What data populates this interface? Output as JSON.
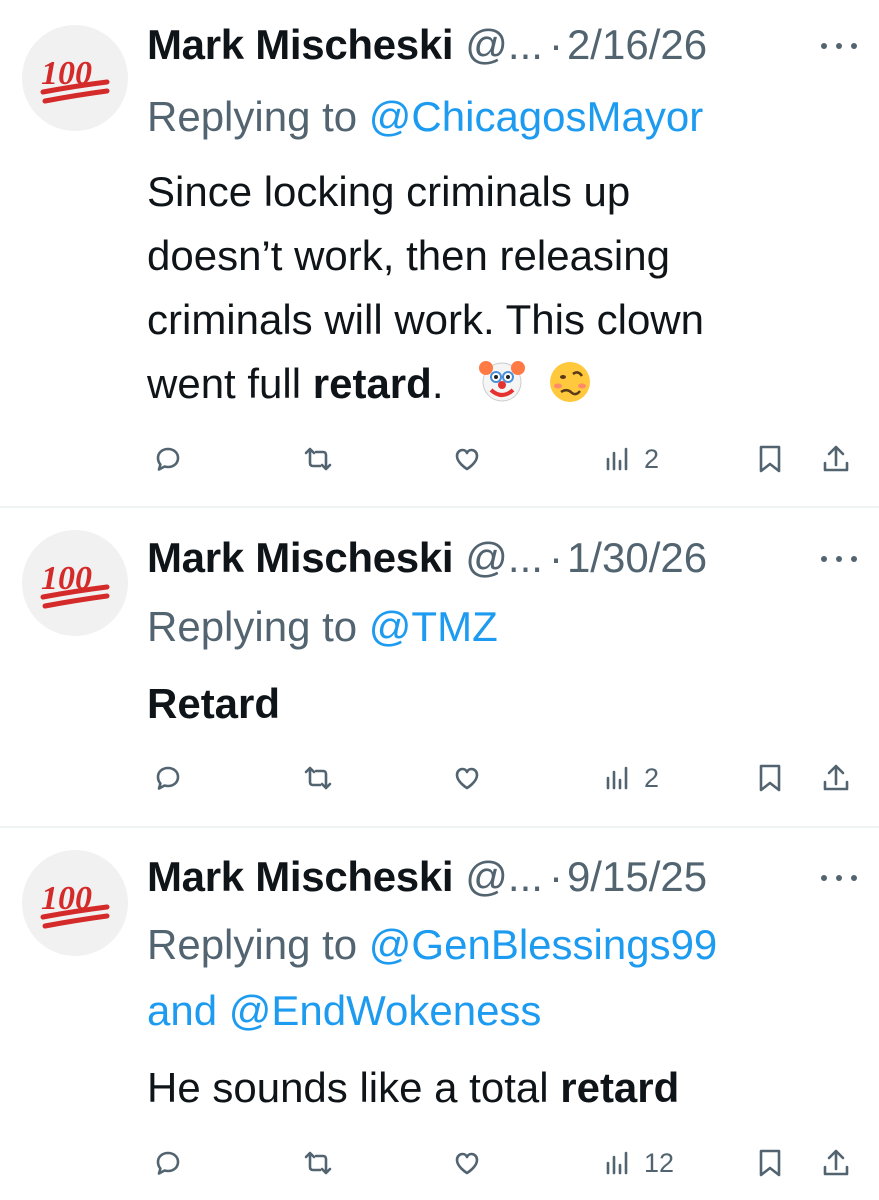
{
  "tweets": [
    {
      "name": "Mark Mischeski",
      "handle": "@...",
      "dot": "·",
      "date": "2/16/26",
      "replying_prefix": "Replying to ",
      "replying_to": "@ChicagosMayor",
      "body_lines": [
        "Since locking criminals up",
        "doesn’t work, then releasing",
        "criminals will work.  This clown"
      ],
      "last_line_prefix": "went full ",
      "last_line_bold": "retard",
      "last_line_suffix": ".",
      "emojis": [
        "clown-face-emoji",
        "woozy-face-emoji"
      ],
      "views": "2"
    },
    {
      "name": "Mark Mischeski",
      "handle": "@...",
      "dot": "·",
      "date": "1/30/26",
      "replying_prefix": "Replying to ",
      "replying_to": "@TMZ",
      "body_bold": "Retard",
      "views": "2"
    },
    {
      "name": "Mark Mischeski",
      "handle": "@...",
      "dot": "·",
      "date": "9/15/25",
      "replying_prefix": "Replying to ",
      "replying_to": "@GenBlessings99",
      "replying_and": "and ",
      "replying_to_2": "@EndWokeness",
      "body_prefix": "He sounds like a total ",
      "body_bold": "retard",
      "views": "12"
    }
  ],
  "avatar_icon": "hundred-points-emoji",
  "avatar_text": "100",
  "colors": {
    "text": "#0f1419",
    "muted": "#536471",
    "link": "#1d9bf0",
    "divider": "#eff3f4",
    "avatar_red": "#d42a2a"
  }
}
